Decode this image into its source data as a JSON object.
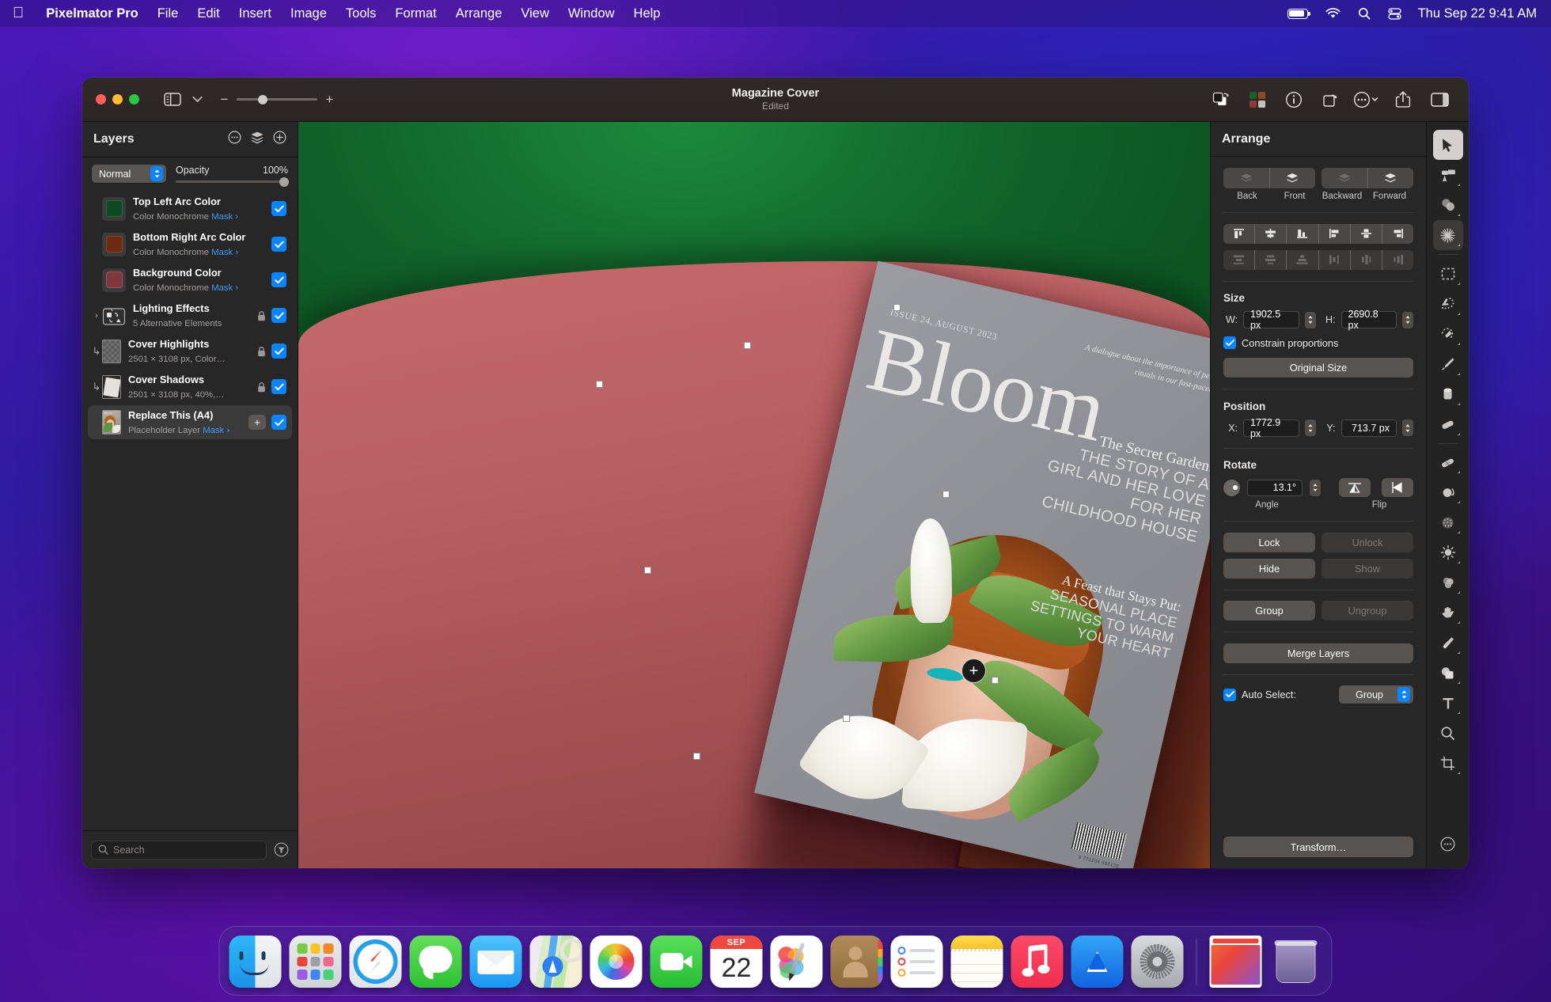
{
  "menubar": {
    "apple_glyph": "",
    "items": [
      "Pixelmator Pro",
      "File",
      "Edit",
      "Insert",
      "Image",
      "Tools",
      "Format",
      "Arrange",
      "View",
      "Window",
      "Help"
    ],
    "status_icons": [
      "battery-icon",
      "wifi-icon",
      "search-icon",
      "control-center-icon"
    ],
    "clock": "Thu Sep 22  9:41 AM"
  },
  "window": {
    "title": "Magazine Cover",
    "subtitle": "Edited",
    "zoom_minus": "−",
    "zoom_plus": "+",
    "toolbar_icons": [
      "duplicate-icon",
      "color-swatches-icon",
      "info-icon",
      "rotate-icon",
      "more-icon",
      "share-icon",
      "right-panel-icon"
    ]
  },
  "layers_panel": {
    "title": "Layers",
    "header_actions": [
      "more-options-icon",
      "layers-stack-icon",
      "add-layer-icon"
    ],
    "blend_mode": "Normal",
    "opacity_label": "Opacity",
    "opacity_value": "100%",
    "search_placeholder": "Search",
    "items": [
      {
        "name": "Top Left Arc Color",
        "subtitle": "Color Monochrome",
        "mask": "Mask ›",
        "swatch": "#0d4a22",
        "type": "swatch",
        "locked": false,
        "visible": true,
        "selected": false,
        "plus": false
      },
      {
        "name": "Bottom Right Arc Color",
        "subtitle": "Color Monochrome",
        "mask": "Mask ›",
        "swatch": "#6b2a12",
        "type": "swatch",
        "locked": false,
        "visible": true,
        "selected": false,
        "plus": false
      },
      {
        "name": "Background Color",
        "subtitle": "Color Monochrome",
        "mask": "Mask ›",
        "swatch": "#7d3a3d",
        "type": "swatch",
        "locked": false,
        "visible": true,
        "selected": false,
        "plus": false
      },
      {
        "name": "Lighting Effects",
        "subtitle": "5 Alternative Elements",
        "mask": "",
        "type": "group",
        "locked": true,
        "visible": true,
        "selected": false,
        "plus": false,
        "disclosure": "›"
      },
      {
        "name": "Cover Highlights",
        "subtitle": "2501 × 3108 px, Color…",
        "mask": "",
        "type": "transparent",
        "locked": true,
        "visible": true,
        "selected": false,
        "plus": false,
        "child": true
      },
      {
        "name": "Cover Shadows",
        "subtitle": "2501 × 3108 px, 40%,…",
        "mask": "",
        "type": "shadow",
        "locked": true,
        "visible": true,
        "selected": false,
        "plus": false,
        "child": true
      },
      {
        "name": "Replace This (A4)",
        "subtitle": "Placeholder Layer",
        "mask": "Mask ›",
        "type": "photo",
        "locked": false,
        "visible": true,
        "selected": true,
        "plus": true
      }
    ]
  },
  "arrange_panel": {
    "title": "Arrange",
    "order_buttons": [
      "Back",
      "Front",
      "Backward",
      "Forward"
    ],
    "size": {
      "label": "Size",
      "w_label": "W:",
      "w_value": "1902.5 px",
      "h_label": "H:",
      "h_value": "2690.8 px",
      "constrain_label": "Constrain proportions",
      "constrain_checked": true,
      "original_size": "Original Size"
    },
    "position": {
      "label": "Position",
      "x_label": "X:",
      "x_value": "1772.9 px",
      "y_label": "Y:",
      "y_value": "713.7 px"
    },
    "rotate": {
      "label": "Rotate",
      "angle_value": "13.1°",
      "angle_label": "Angle",
      "flip_label": "Flip"
    },
    "actions": {
      "lock": "Lock",
      "unlock": "Unlock",
      "hide": "Hide",
      "show": "Show",
      "group": "Group",
      "ungroup": "Ungroup",
      "merge": "Merge Layers"
    },
    "auto_select": {
      "label": "Auto Select:",
      "checked": true,
      "value": "Group"
    },
    "transform": "Transform…"
  },
  "tools": [
    {
      "name": "arrange-tool",
      "glyph": "arrow",
      "active": true
    },
    {
      "name": "style-tool",
      "glyph": "brush-roller",
      "active": false
    },
    {
      "name": "color-adjustments-tool",
      "glyph": "circles",
      "active": false
    },
    {
      "name": "effects-tool",
      "glyph": "sparkle",
      "active": false,
      "highlight": true
    },
    {
      "name": "rectangular-select-tool",
      "glyph": "marquee",
      "active": false
    },
    {
      "name": "quick-select-tool",
      "glyph": "quickselect",
      "active": false
    },
    {
      "name": "paint-select-tool",
      "glyph": "paintselect",
      "active": false
    },
    {
      "name": "paint-tool",
      "glyph": "paintbrush",
      "active": false
    },
    {
      "name": "paint-bucket-tool",
      "glyph": "bucket",
      "active": false
    },
    {
      "name": "eraser-tool",
      "glyph": "eraser",
      "active": false
    },
    {
      "name": "repair-tool",
      "glyph": "bandaid",
      "active": false
    },
    {
      "name": "clone-tool",
      "glyph": "clone",
      "active": false
    },
    {
      "name": "smudge-tool",
      "glyph": "halftone",
      "active": false
    },
    {
      "name": "lighten-tool",
      "glyph": "sun",
      "active": false
    },
    {
      "name": "saturation-tool",
      "glyph": "blobs",
      "active": false
    },
    {
      "name": "distort-tool",
      "glyph": "hand",
      "active": false
    },
    {
      "name": "pen-tool",
      "glyph": "pen",
      "active": false
    },
    {
      "name": "shape-tool",
      "glyph": "shapes",
      "active": false
    },
    {
      "name": "type-tool",
      "glyph": "T",
      "active": false
    },
    {
      "name": "zoom-tool",
      "glyph": "magnifier",
      "active": false
    },
    {
      "name": "crop-tool",
      "glyph": "crop",
      "active": false
    },
    {
      "name": "more-tools",
      "glyph": "ellipsis",
      "active": false
    }
  ],
  "canvas": {
    "magazine": {
      "issue": "ISSUE 24, AUGUST 2023",
      "masthead": "Bloom",
      "kicker": "A dialogue about the importance of personal rituals in our fast-paced life.",
      "headline1_serif": "The Secret Garden:",
      "headline1_sans": "THE STORY OF A GIRL AND HER LOVE FOR HER CHILDHOOD HOUSE",
      "headline2_serif": "A Feast that Stays Put:",
      "headline2_sans": "SEASONAL PLACE SETTINGS TO WARM YOUR HEART",
      "barcode_text": "9 771234 560128"
    },
    "add_button": "+"
  },
  "dock": {
    "apps": [
      {
        "name": "finder",
        "running": true
      },
      {
        "name": "launchpad",
        "running": false
      },
      {
        "name": "safari",
        "running": false
      },
      {
        "name": "messages",
        "running": false
      },
      {
        "name": "mail",
        "running": false
      },
      {
        "name": "maps",
        "running": false
      },
      {
        "name": "photos",
        "running": false
      },
      {
        "name": "facetime",
        "running": false
      },
      {
        "name": "calendar",
        "running": false,
        "month": "SEP",
        "day": "22"
      },
      {
        "name": "pixelmator-pro",
        "running": true
      },
      {
        "name": "contacts",
        "running": false
      },
      {
        "name": "reminders",
        "running": false
      },
      {
        "name": "notes",
        "running": false
      },
      {
        "name": "music",
        "running": false
      },
      {
        "name": "app-store",
        "running": false
      },
      {
        "name": "system-settings",
        "running": false
      },
      {
        "name": "downloads-stack",
        "running": false
      },
      {
        "name": "trash",
        "running": false
      }
    ]
  }
}
